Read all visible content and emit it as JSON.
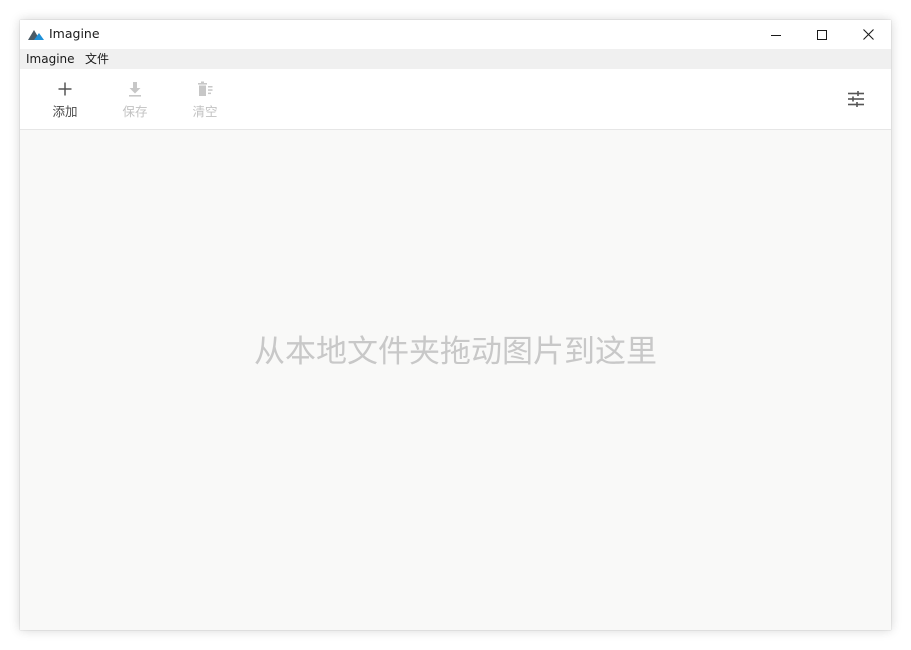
{
  "window": {
    "title": "Imagine",
    "app_icon": "mountain-logo-icon",
    "controls": {
      "minimize_icon": "minimize-icon",
      "maximize_icon": "maximize-icon",
      "close_icon": "close-icon"
    }
  },
  "menubar": {
    "items": [
      {
        "label": "Imagine"
      },
      {
        "label": "文件"
      }
    ]
  },
  "toolbar": {
    "add": {
      "label": "添加",
      "icon": "plus-icon",
      "enabled": true
    },
    "save": {
      "label": "保存",
      "icon": "download-icon",
      "enabled": false
    },
    "clear": {
      "label": "清空",
      "icon": "clear-list-icon",
      "enabled": false
    },
    "settings": {
      "icon": "sliders-icon"
    }
  },
  "canvas": {
    "drop_hint": "从本地文件夹拖动图片到这里"
  },
  "colors": {
    "logo_dark": "#4a5a66",
    "logo_blue": "#1e90d8",
    "icon_enabled": "#555555",
    "icon_disabled": "#c7c7c7",
    "canvas_bg": "#f9f9f8",
    "menubar_bg": "#f0f0f0",
    "hint_text": "#c8c8c8"
  }
}
